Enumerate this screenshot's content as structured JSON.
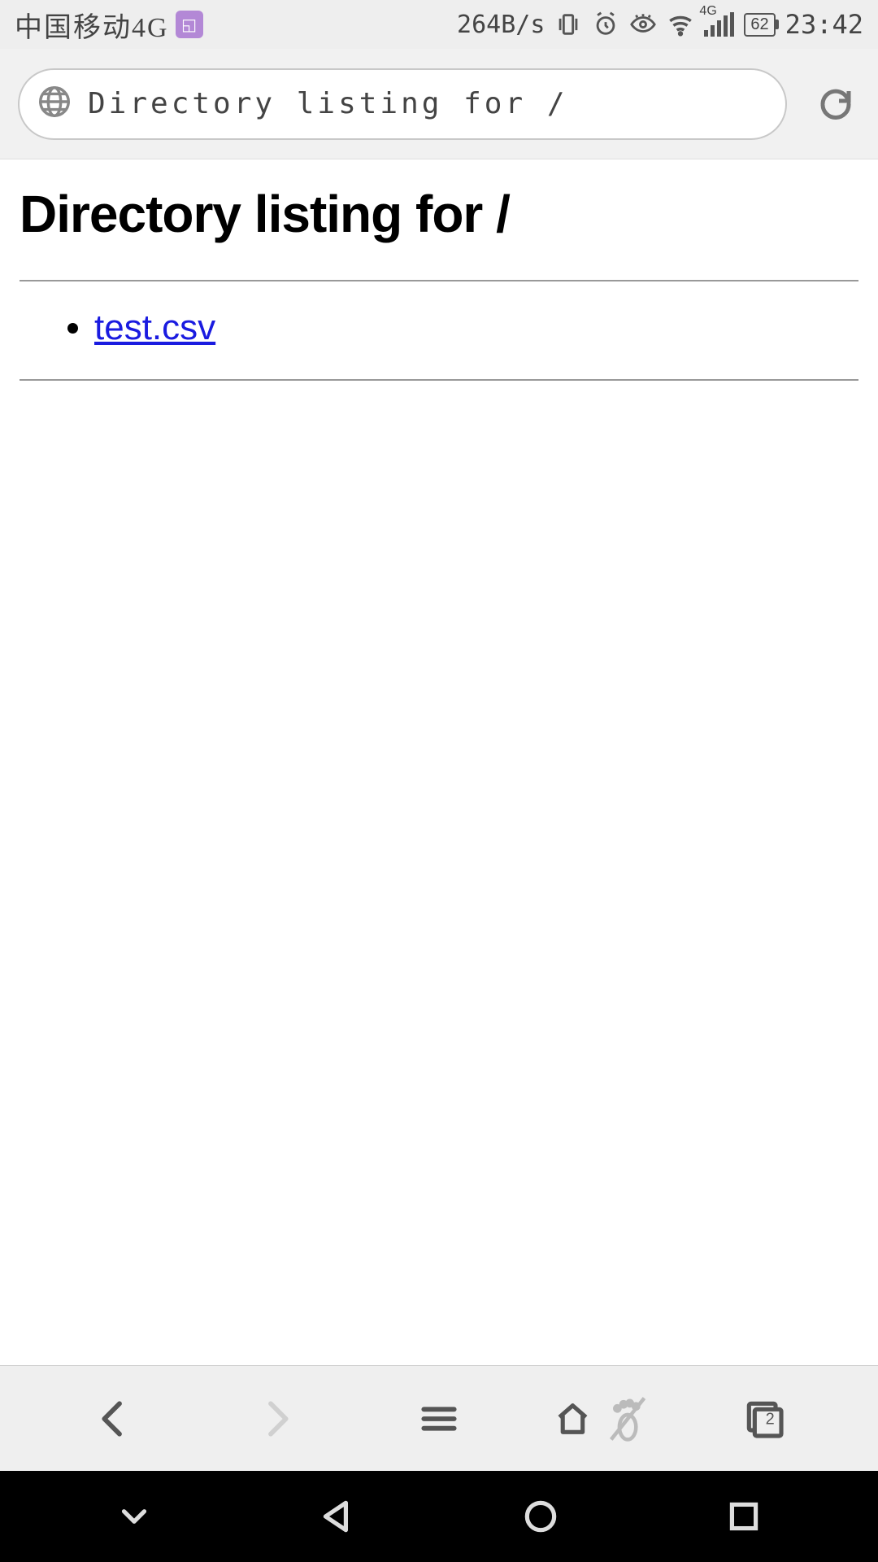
{
  "status": {
    "carrier": "中国移动4G",
    "speed": "264B/s",
    "signal_type": "4G",
    "battery": "62",
    "time": "23:42"
  },
  "browser": {
    "url_label": "Directory listing for /",
    "tab_count": "2"
  },
  "page": {
    "heading": "Directory listing for /",
    "files": [
      {
        "name": "test.csv"
      }
    ]
  }
}
